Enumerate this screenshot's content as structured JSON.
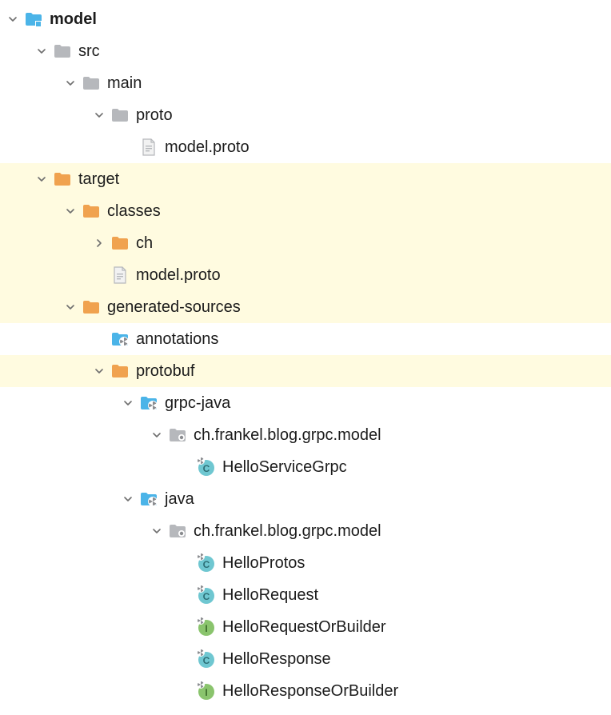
{
  "colors": {
    "highlight": "#fffbe0",
    "folder_gray": "#b6b8bc",
    "folder_orange": "#f0a24f",
    "folder_blue": "#4bb4e8",
    "module_blue": "#4bb4e8",
    "package_gray": "#b6b8bc",
    "file": "#b6b8bc",
    "class_fill": "#6fc7d1",
    "interface_fill": "#8ac46d",
    "chevron": "#6e6e6e"
  },
  "tree": [
    {
      "depth": 0,
      "expand": "down",
      "icon": "module",
      "label": "model",
      "highlight": false,
      "bold": true
    },
    {
      "depth": 1,
      "expand": "down",
      "icon": "folder-gray",
      "label": "src",
      "highlight": false,
      "bold": false
    },
    {
      "depth": 2,
      "expand": "down",
      "icon": "folder-gray",
      "label": "main",
      "highlight": false,
      "bold": false
    },
    {
      "depth": 3,
      "expand": "down",
      "icon": "folder-gray",
      "label": "proto",
      "highlight": false,
      "bold": false
    },
    {
      "depth": 4,
      "expand": "none",
      "icon": "file",
      "label": "model.proto",
      "highlight": false,
      "bold": false
    },
    {
      "depth": 1,
      "expand": "down",
      "icon": "folder-orange",
      "label": "target",
      "highlight": true,
      "bold": false
    },
    {
      "depth": 2,
      "expand": "down",
      "icon": "folder-orange",
      "label": "classes",
      "highlight": true,
      "bold": false
    },
    {
      "depth": 3,
      "expand": "right",
      "icon": "folder-orange",
      "label": "ch",
      "highlight": true,
      "bold": false
    },
    {
      "depth": 3,
      "expand": "none",
      "icon": "file",
      "label": "model.proto",
      "highlight": true,
      "bold": false
    },
    {
      "depth": 2,
      "expand": "down",
      "icon": "folder-orange",
      "label": "generated-sources",
      "highlight": true,
      "bold": false
    },
    {
      "depth": 3,
      "expand": "none",
      "icon": "folder-gen",
      "label": "annotations",
      "highlight": false,
      "bold": false
    },
    {
      "depth": 3,
      "expand": "down",
      "icon": "folder-orange",
      "label": "protobuf",
      "highlight": true,
      "bold": false
    },
    {
      "depth": 4,
      "expand": "down",
      "icon": "folder-gen",
      "label": "grpc-java",
      "highlight": false,
      "bold": false
    },
    {
      "depth": 5,
      "expand": "down",
      "icon": "package",
      "label": "ch.frankel.blog.grpc.model",
      "highlight": false,
      "bold": false
    },
    {
      "depth": 6,
      "expand": "none",
      "icon": "class",
      "label": "HelloServiceGrpc",
      "highlight": false,
      "bold": false
    },
    {
      "depth": 4,
      "expand": "down",
      "icon": "folder-gen",
      "label": "java",
      "highlight": false,
      "bold": false
    },
    {
      "depth": 5,
      "expand": "down",
      "icon": "package",
      "label": "ch.frankel.blog.grpc.model",
      "highlight": false,
      "bold": false
    },
    {
      "depth": 6,
      "expand": "none",
      "icon": "class",
      "label": "HelloProtos",
      "highlight": false,
      "bold": false
    },
    {
      "depth": 6,
      "expand": "none",
      "icon": "class",
      "label": "HelloRequest",
      "highlight": false,
      "bold": false
    },
    {
      "depth": 6,
      "expand": "none",
      "icon": "interface",
      "label": "HelloRequestOrBuilder",
      "highlight": false,
      "bold": false
    },
    {
      "depth": 6,
      "expand": "none",
      "icon": "class",
      "label": "HelloResponse",
      "highlight": false,
      "bold": false
    },
    {
      "depth": 6,
      "expand": "none",
      "icon": "interface",
      "label": "HelloResponseOrBuilder",
      "highlight": false,
      "bold": false
    }
  ]
}
